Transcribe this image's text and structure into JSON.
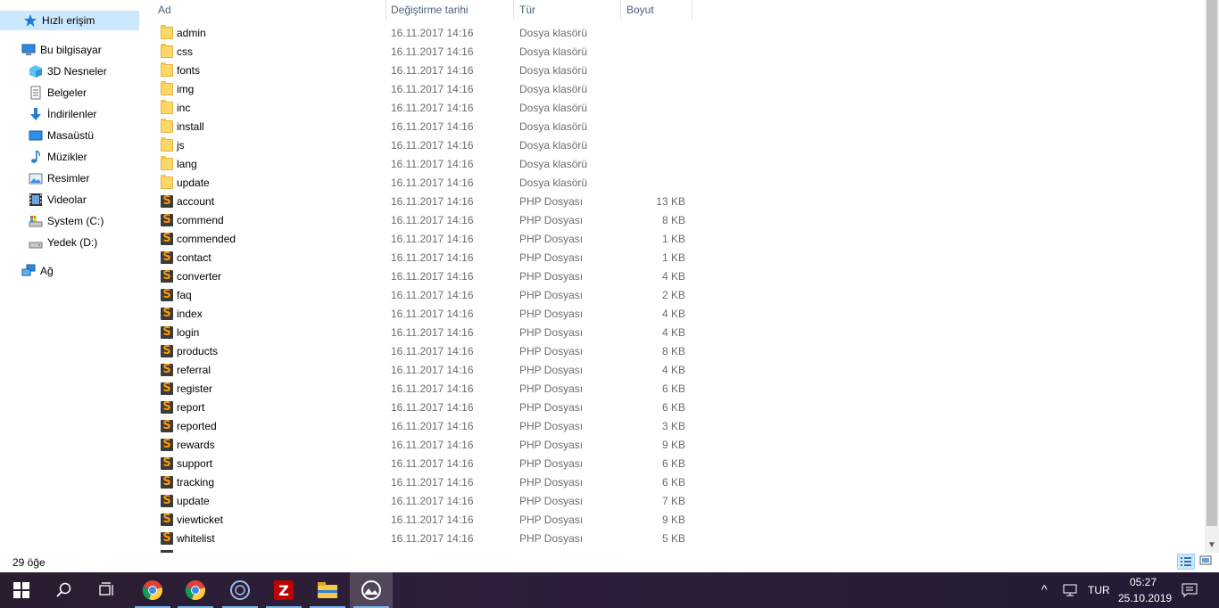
{
  "nav": {
    "quick_access": "Hızlı erişim",
    "this_pc": "Bu bilgisayar",
    "items": [
      {
        "label": "3D Nesneler",
        "icon": "cube-3d-icon"
      },
      {
        "label": "Belgeler",
        "icon": "document-icon"
      },
      {
        "label": "İndirilenler",
        "icon": "download-arrow-icon"
      },
      {
        "label": "Masaüstü",
        "icon": "desktop-icon"
      },
      {
        "label": "Müzikler",
        "icon": "music-note-icon"
      },
      {
        "label": "Resimler",
        "icon": "pictures-icon"
      },
      {
        "label": "Videolar",
        "icon": "film-icon"
      },
      {
        "label": "System (C:)",
        "icon": "system-drive-icon"
      },
      {
        "label": "Yedek (D:)",
        "icon": "drive-icon"
      }
    ],
    "network": "Ağ"
  },
  "columns": {
    "name": "Ad",
    "date": "Değiştirme tarihi",
    "type": "Tür",
    "size": "Boyut"
  },
  "files": [
    {
      "name": "admin",
      "date": "16.11.2017 14:16",
      "type": "Dosya klasörü",
      "size": "",
      "kind": "folder"
    },
    {
      "name": "css",
      "date": "16.11.2017 14:16",
      "type": "Dosya klasörü",
      "size": "",
      "kind": "folder"
    },
    {
      "name": "fonts",
      "date": "16.11.2017 14:16",
      "type": "Dosya klasörü",
      "size": "",
      "kind": "folder"
    },
    {
      "name": "img",
      "date": "16.11.2017 14:16",
      "type": "Dosya klasörü",
      "size": "",
      "kind": "folder"
    },
    {
      "name": "inc",
      "date": "16.11.2017 14:16",
      "type": "Dosya klasörü",
      "size": "",
      "kind": "folder"
    },
    {
      "name": "install",
      "date": "16.11.2017 14:16",
      "type": "Dosya klasörü",
      "size": "",
      "kind": "folder"
    },
    {
      "name": "js",
      "date": "16.11.2017 14:16",
      "type": "Dosya klasörü",
      "size": "",
      "kind": "folder"
    },
    {
      "name": "lang",
      "date": "16.11.2017 14:16",
      "type": "Dosya klasörü",
      "size": "",
      "kind": "folder"
    },
    {
      "name": "update",
      "date": "16.11.2017 14:16",
      "type": "Dosya klasörü",
      "size": "",
      "kind": "folder"
    },
    {
      "name": "account",
      "date": "16.11.2017 14:16",
      "type": "PHP Dosyası",
      "size": "13 KB",
      "kind": "php"
    },
    {
      "name": "commend",
      "date": "16.11.2017 14:16",
      "type": "PHP Dosyası",
      "size": "8 KB",
      "kind": "php"
    },
    {
      "name": "commended",
      "date": "16.11.2017 14:16",
      "type": "PHP Dosyası",
      "size": "1 KB",
      "kind": "php"
    },
    {
      "name": "contact",
      "date": "16.11.2017 14:16",
      "type": "PHP Dosyası",
      "size": "1 KB",
      "kind": "php"
    },
    {
      "name": "converter",
      "date": "16.11.2017 14:16",
      "type": "PHP Dosyası",
      "size": "4 KB",
      "kind": "php"
    },
    {
      "name": "faq",
      "date": "16.11.2017 14:16",
      "type": "PHP Dosyası",
      "size": "2 KB",
      "kind": "php"
    },
    {
      "name": "index",
      "date": "16.11.2017 14:16",
      "type": "PHP Dosyası",
      "size": "4 KB",
      "kind": "php"
    },
    {
      "name": "login",
      "date": "16.11.2017 14:16",
      "type": "PHP Dosyası",
      "size": "4 KB",
      "kind": "php"
    },
    {
      "name": "products",
      "date": "16.11.2017 14:16",
      "type": "PHP Dosyası",
      "size": "8 KB",
      "kind": "php"
    },
    {
      "name": "referral",
      "date": "16.11.2017 14:16",
      "type": "PHP Dosyası",
      "size": "4 KB",
      "kind": "php"
    },
    {
      "name": "register",
      "date": "16.11.2017 14:16",
      "type": "PHP Dosyası",
      "size": "6 KB",
      "kind": "php"
    },
    {
      "name": "report",
      "date": "16.11.2017 14:16",
      "type": "PHP Dosyası",
      "size": "6 KB",
      "kind": "php"
    },
    {
      "name": "reported",
      "date": "16.11.2017 14:16",
      "type": "PHP Dosyası",
      "size": "3 KB",
      "kind": "php"
    },
    {
      "name": "rewards",
      "date": "16.11.2017 14:16",
      "type": "PHP Dosyası",
      "size": "9 KB",
      "kind": "php"
    },
    {
      "name": "support",
      "date": "16.11.2017 14:16",
      "type": "PHP Dosyası",
      "size": "6 KB",
      "kind": "php"
    },
    {
      "name": "tracking",
      "date": "16.11.2017 14:16",
      "type": "PHP Dosyası",
      "size": "6 KB",
      "kind": "php"
    },
    {
      "name": "update",
      "date": "16.11.2017 14:16",
      "type": "PHP Dosyası",
      "size": "7 KB",
      "kind": "php"
    },
    {
      "name": "viewticket",
      "date": "16.11.2017 14:16",
      "type": "PHP Dosyası",
      "size": "9 KB",
      "kind": "php"
    },
    {
      "name": "whitelist",
      "date": "16.11.2017 14:16",
      "type": "PHP Dosyası",
      "size": "5 KB",
      "kind": "php"
    }
  ],
  "status": {
    "item_count": "29 öğe"
  },
  "taskbar": {
    "apps": [
      {
        "name": "chrome-icon"
      },
      {
        "name": "chrome-icon"
      },
      {
        "name": "cortana-app-icon"
      },
      {
        "name": "filezilla-icon"
      },
      {
        "name": "file-explorer-icon"
      },
      {
        "name": "photos-app-icon"
      }
    ],
    "language": "TUR",
    "time": "05:27",
    "date": "25.10.2019"
  },
  "colors": {
    "selection": "#cce8ff",
    "header_text": "#4c607a",
    "taskbar": "#2d1f3b",
    "folder": "#ffd766",
    "php_accent": "#ff9800"
  }
}
